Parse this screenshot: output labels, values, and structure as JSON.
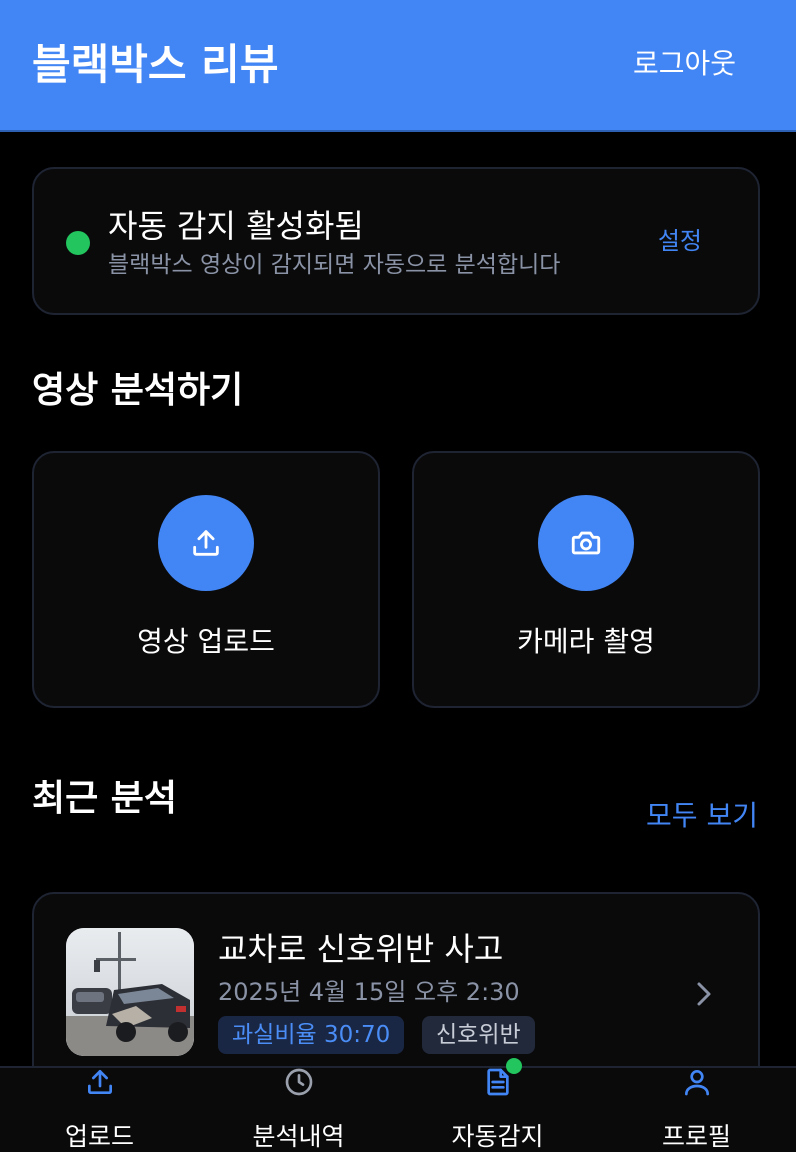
{
  "header": {
    "title": "블랙박스 리뷰",
    "logout_label": "로그아웃"
  },
  "auto_detect": {
    "status_color": "#22c55e",
    "title": "자동 감지 활성화됨",
    "subtitle": "블랙박스 영상이 감지되면 자동으로 분석합니다",
    "settings_label": "설정"
  },
  "analyze_section": {
    "title": "영상 분석하기",
    "actions": [
      {
        "label": "영상 업로드",
        "icon": "upload-icon"
      },
      {
        "label": "카메라 촬영",
        "icon": "camera-icon"
      }
    ]
  },
  "recent_section": {
    "title": "최근 분석",
    "view_all_label": "모두 보기",
    "items": [
      {
        "title": "교차로 신호위반 사고",
        "date": "2025년 4월 15일 오후 2:30",
        "tags": [
          "과실비율 30:70",
          "신호위반"
        ]
      }
    ]
  },
  "bottom_nav": {
    "items": [
      {
        "label": "업로드",
        "icon": "upload-icon"
      },
      {
        "label": "분석내역",
        "icon": "clock-icon"
      },
      {
        "label": "자동감지",
        "icon": "document-icon",
        "badge": true
      },
      {
        "label": "프로필",
        "icon": "user-icon"
      }
    ]
  },
  "colors": {
    "accent": "#4285f4",
    "background": "#000000",
    "card": "#0a0a0b",
    "border": "#1f2433",
    "active": "#22c55e",
    "muted_text": "#8a93a6"
  }
}
